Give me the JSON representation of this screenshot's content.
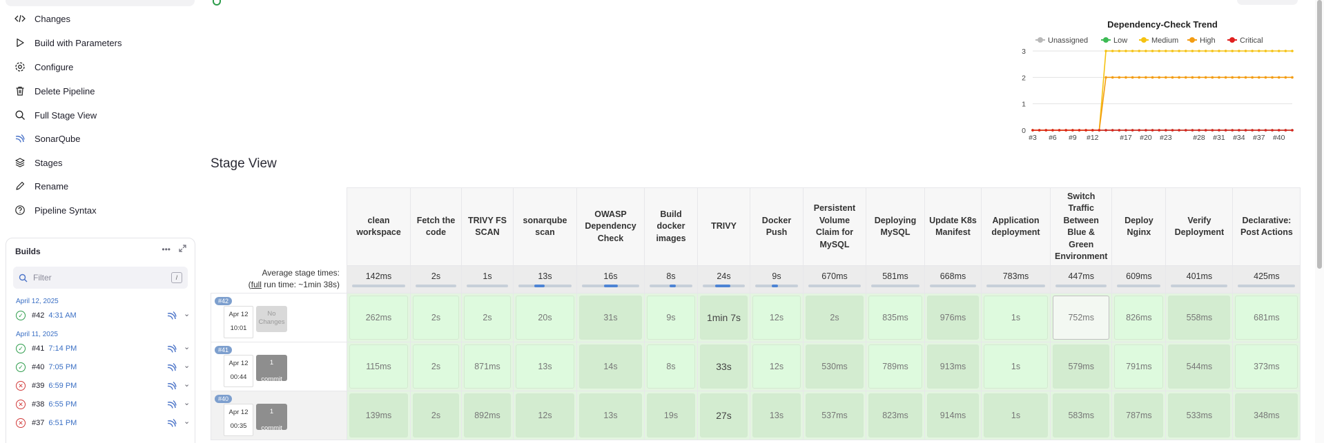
{
  "sidebar": {
    "tasks": [
      {
        "label": "Changes",
        "icon": "code-icon"
      },
      {
        "label": "Build with Parameters",
        "icon": "play-icon"
      },
      {
        "label": "Configure",
        "icon": "gear-icon"
      },
      {
        "label": "Delete Pipeline",
        "icon": "trash-icon"
      },
      {
        "label": "Full Stage View",
        "icon": "search-icon"
      },
      {
        "label": "SonarQube",
        "icon": "sonarqube-icon"
      },
      {
        "label": "Stages",
        "icon": "layers-icon"
      },
      {
        "label": "Rename",
        "icon": "pencil-icon"
      },
      {
        "label": "Pipeline Syntax",
        "icon": "help-icon"
      }
    ]
  },
  "builds": {
    "title": "Builds",
    "filter_placeholder": "Filter",
    "filter_shortcut": "/",
    "groups": [
      {
        "date": "April 12, 2025",
        "items": [
          {
            "num": "#42",
            "time": "4:31 AM",
            "status": "success"
          }
        ]
      },
      {
        "date": "April 11, 2025",
        "items": [
          {
            "num": "#41",
            "time": "7:14 PM",
            "status": "success"
          },
          {
            "num": "#40",
            "time": "7:05 PM",
            "status": "success"
          },
          {
            "num": "#39",
            "time": "6:59 PM",
            "status": "failed"
          },
          {
            "num": "#38",
            "time": "6:55 PM",
            "status": "failed"
          },
          {
            "num": "#37",
            "time": "6:51 PM",
            "status": "failed"
          }
        ]
      }
    ]
  },
  "chart_data": {
    "type": "line",
    "title": "Dependency-Check Trend",
    "x": [
      "#3",
      "#4",
      "#5",
      "#6",
      "#7",
      "#8",
      "#9",
      "#10",
      "#11",
      "#12",
      "#13",
      "#14",
      "#15",
      "#16",
      "#17",
      "#18",
      "#19",
      "#20",
      "#21",
      "#22",
      "#23",
      "#24",
      "#25",
      "#26",
      "#27",
      "#28",
      "#29",
      "#30",
      "#31",
      "#32",
      "#33",
      "#34",
      "#35",
      "#36",
      "#37",
      "#38",
      "#39",
      "#40",
      "#41",
      "#42"
    ],
    "x_tick_labels": [
      "#3",
      "#6",
      "#9",
      "#12",
      "#17",
      "#20",
      "#23",
      "#28",
      "#31",
      "#34",
      "#37",
      "#40"
    ],
    "ylim": [
      0,
      3
    ],
    "y_ticks": [
      0,
      1,
      2,
      3
    ],
    "legend_position": "top",
    "series": [
      {
        "name": "Unassigned",
        "color": "#b8b8b8",
        "values": [
          0,
          0,
          0,
          0,
          0,
          0,
          0,
          0,
          0,
          0,
          0,
          0,
          0,
          0,
          0,
          0,
          0,
          0,
          0,
          0,
          0,
          0,
          0,
          0,
          0,
          0,
          0,
          0,
          0,
          0,
          0,
          0,
          0,
          0,
          0,
          0,
          0,
          0,
          0,
          0
        ]
      },
      {
        "name": "Low",
        "color": "#3cba54",
        "values": [
          0,
          0,
          0,
          0,
          0,
          0,
          0,
          0,
          0,
          0,
          0,
          0,
          0,
          0,
          0,
          0,
          0,
          0,
          0,
          0,
          0,
          0,
          0,
          0,
          0,
          0,
          0,
          0,
          0,
          0,
          0,
          0,
          0,
          0,
          0,
          0,
          0,
          0,
          0,
          0
        ]
      },
      {
        "name": "Medium",
        "color": "#f5c211",
        "values": [
          0,
          0,
          0,
          0,
          0,
          0,
          0,
          0,
          0,
          0,
          0,
          3,
          3,
          3,
          3,
          3,
          3,
          3,
          3,
          3,
          3,
          3,
          3,
          3,
          3,
          3,
          3,
          3,
          3,
          3,
          3,
          3,
          3,
          3,
          3,
          3,
          3,
          3,
          3,
          3
        ]
      },
      {
        "name": "High",
        "color": "#f39c12",
        "values": [
          0,
          0,
          0,
          0,
          0,
          0,
          0,
          0,
          0,
          0,
          0,
          2,
          2,
          2,
          2,
          2,
          2,
          2,
          2,
          2,
          2,
          2,
          2,
          2,
          2,
          2,
          2,
          2,
          2,
          2,
          2,
          2,
          2,
          2,
          2,
          2,
          2,
          2,
          2,
          2
        ]
      },
      {
        "name": "Critical",
        "color": "#e0201f",
        "values": [
          0,
          0,
          0,
          0,
          0,
          0,
          0,
          0,
          0,
          0,
          0,
          0,
          0,
          0,
          0,
          0,
          0,
          0,
          0,
          0,
          0,
          0,
          0,
          0,
          0,
          0,
          0,
          0,
          0,
          0,
          0,
          0,
          0,
          0,
          0,
          0,
          0,
          0,
          0,
          0
        ]
      }
    ]
  },
  "stage_view": {
    "title": "Stage View",
    "avg_label": "Average stage times:",
    "full_run_prefix": "(",
    "full_run_link": "full",
    "full_run_suffix": " run time: ~1min 38s)",
    "stages": [
      {
        "name": "clean workspace",
        "avg": "142ms",
        "avg_progress": 0
      },
      {
        "name": "Fetch the code",
        "avg": "2s",
        "avg_progress": 0
      },
      {
        "name": "TRIVY FS SCAN",
        "avg": "1s",
        "avg_progress": 0
      },
      {
        "name": "sonarqube scan",
        "avg": "13s",
        "avg_progress": 0.2
      },
      {
        "name": "OWASP Dependency Check",
        "avg": "16s",
        "avg_progress": 0.25
      },
      {
        "name": "Build docker images",
        "avg": "8s",
        "avg_progress": 0.15
      },
      {
        "name": "TRIVY",
        "avg": "24s",
        "avg_progress": 0.35
      },
      {
        "name": "Docker Push",
        "avg": "9s",
        "avg_progress": 0.15
      },
      {
        "name": "Persistent Volume Claim for MySQL",
        "avg": "670ms",
        "avg_progress": 0
      },
      {
        "name": "Deploying MySQL",
        "avg": "581ms",
        "avg_progress": 0
      },
      {
        "name": "Update K8s Manifest",
        "avg": "668ms",
        "avg_progress": 0
      },
      {
        "name": "Application deployment",
        "avg": "783ms",
        "avg_progress": 0
      },
      {
        "name": "Switch Traffic Between Blue & Green Environment",
        "avg": "447ms",
        "avg_progress": 0
      },
      {
        "name": "Deploy Nginx",
        "avg": "609ms",
        "avg_progress": 0
      },
      {
        "name": "Verify Deployment",
        "avg": "401ms",
        "avg_progress": 0
      },
      {
        "name": "Declarative: Post Actions",
        "avg": "425ms",
        "avg_progress": 0
      }
    ],
    "runs": [
      {
        "badge": "#42",
        "date": "Apr 12",
        "time": "10:01",
        "changes_top": "No",
        "changes_bottom": "Changes",
        "type": "none",
        "times": [
          "262ms",
          "2s",
          "2s",
          "20s",
          "31s",
          "9s",
          "1min 7s",
          "12s",
          "2s",
          "835ms",
          "976ms",
          "1s",
          "752ms",
          "826ms",
          "558ms",
          "681ms"
        ]
      },
      {
        "badge": "#41",
        "date": "Apr 12",
        "time": "00:44",
        "changes_top": "1",
        "changes_bottom": "commit",
        "type": "commit",
        "times": [
          "115ms",
          "2s",
          "871ms",
          "13s",
          "14s",
          "8s",
          "33s",
          "12s",
          "530ms",
          "789ms",
          "913ms",
          "1s",
          "579ms",
          "791ms",
          "544ms",
          "373ms"
        ]
      },
      {
        "badge": "#40",
        "date": "Apr 12",
        "time": "00:35",
        "changes_top": "1",
        "changes_bottom": "commit",
        "type": "commit",
        "times": [
          "139ms",
          "2s",
          "892ms",
          "12s",
          "13s",
          "19s",
          "27s",
          "13s",
          "537ms",
          "823ms",
          "914ms",
          "1s",
          "583ms",
          "787ms",
          "533ms",
          "348ms"
        ]
      }
    ]
  }
}
